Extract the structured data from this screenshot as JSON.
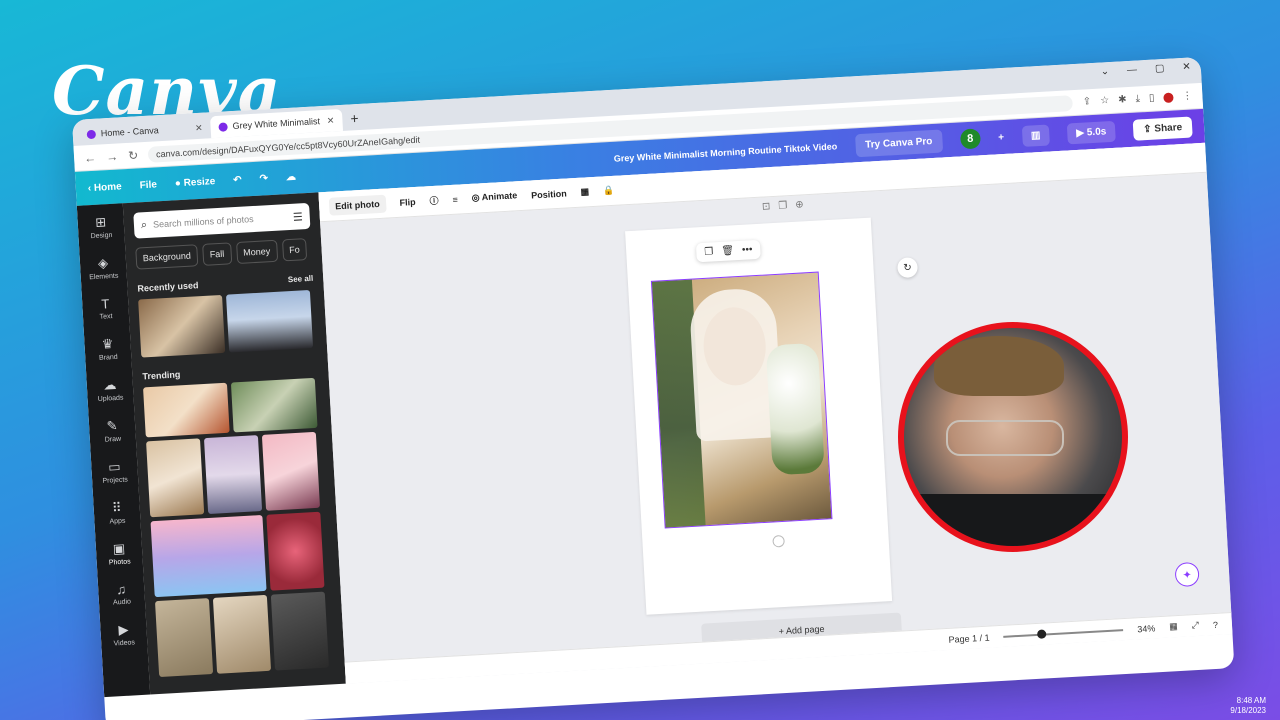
{
  "brand": {
    "logo_text": "Canva"
  },
  "browser": {
    "tabs": [
      {
        "label": "Home - Canva",
        "active": false
      },
      {
        "label": "Grey White Minimalist Morning",
        "active": true
      }
    ],
    "url": "canva.com/design/DAFuxQYG0Ye/cc5pt8Vcy60UrZAneIGahg/edit"
  },
  "canva_header": {
    "home": "Home",
    "file": "File",
    "resize": "Resize",
    "title": "Grey White Minimalist Morning Routine Tiktok Video",
    "try_pro": "Try Canva Pro",
    "avatar_initial": "8",
    "duration": "5.0s",
    "share": "Share"
  },
  "rail": [
    {
      "label": "Design",
      "icon": "⊞"
    },
    {
      "label": "Elements",
      "icon": "◈"
    },
    {
      "label": "Text",
      "icon": "T"
    },
    {
      "label": "Brand",
      "icon": "♛"
    },
    {
      "label": "Uploads",
      "icon": "☁"
    },
    {
      "label": "Draw",
      "icon": "✎"
    },
    {
      "label": "Projects",
      "icon": "▭"
    },
    {
      "label": "Apps",
      "icon": "⠿"
    },
    {
      "label": "Photos",
      "icon": "▣"
    },
    {
      "label": "Audio",
      "icon": "♫"
    },
    {
      "label": "Videos",
      "icon": "▶"
    }
  ],
  "panel": {
    "search_placeholder": "Search millions of photos",
    "chips": [
      "Background",
      "Fall",
      "Money",
      "Fo"
    ],
    "recently_used": "Recently used",
    "see_all": "See all",
    "trending": "Trending"
  },
  "toolbar": {
    "edit_photo": "Edit photo",
    "flip": "Flip",
    "animate": "Animate",
    "position": "Position"
  },
  "canvas": {
    "add_page": "+ Add page"
  },
  "status": {
    "page_indicator": "Page 1 / 1",
    "zoom": "34%",
    "time": "8:48 AM",
    "date": "9/18/2023"
  },
  "colors": {
    "accent": "#8b3dff",
    "webcam_ring": "#e8121c"
  }
}
